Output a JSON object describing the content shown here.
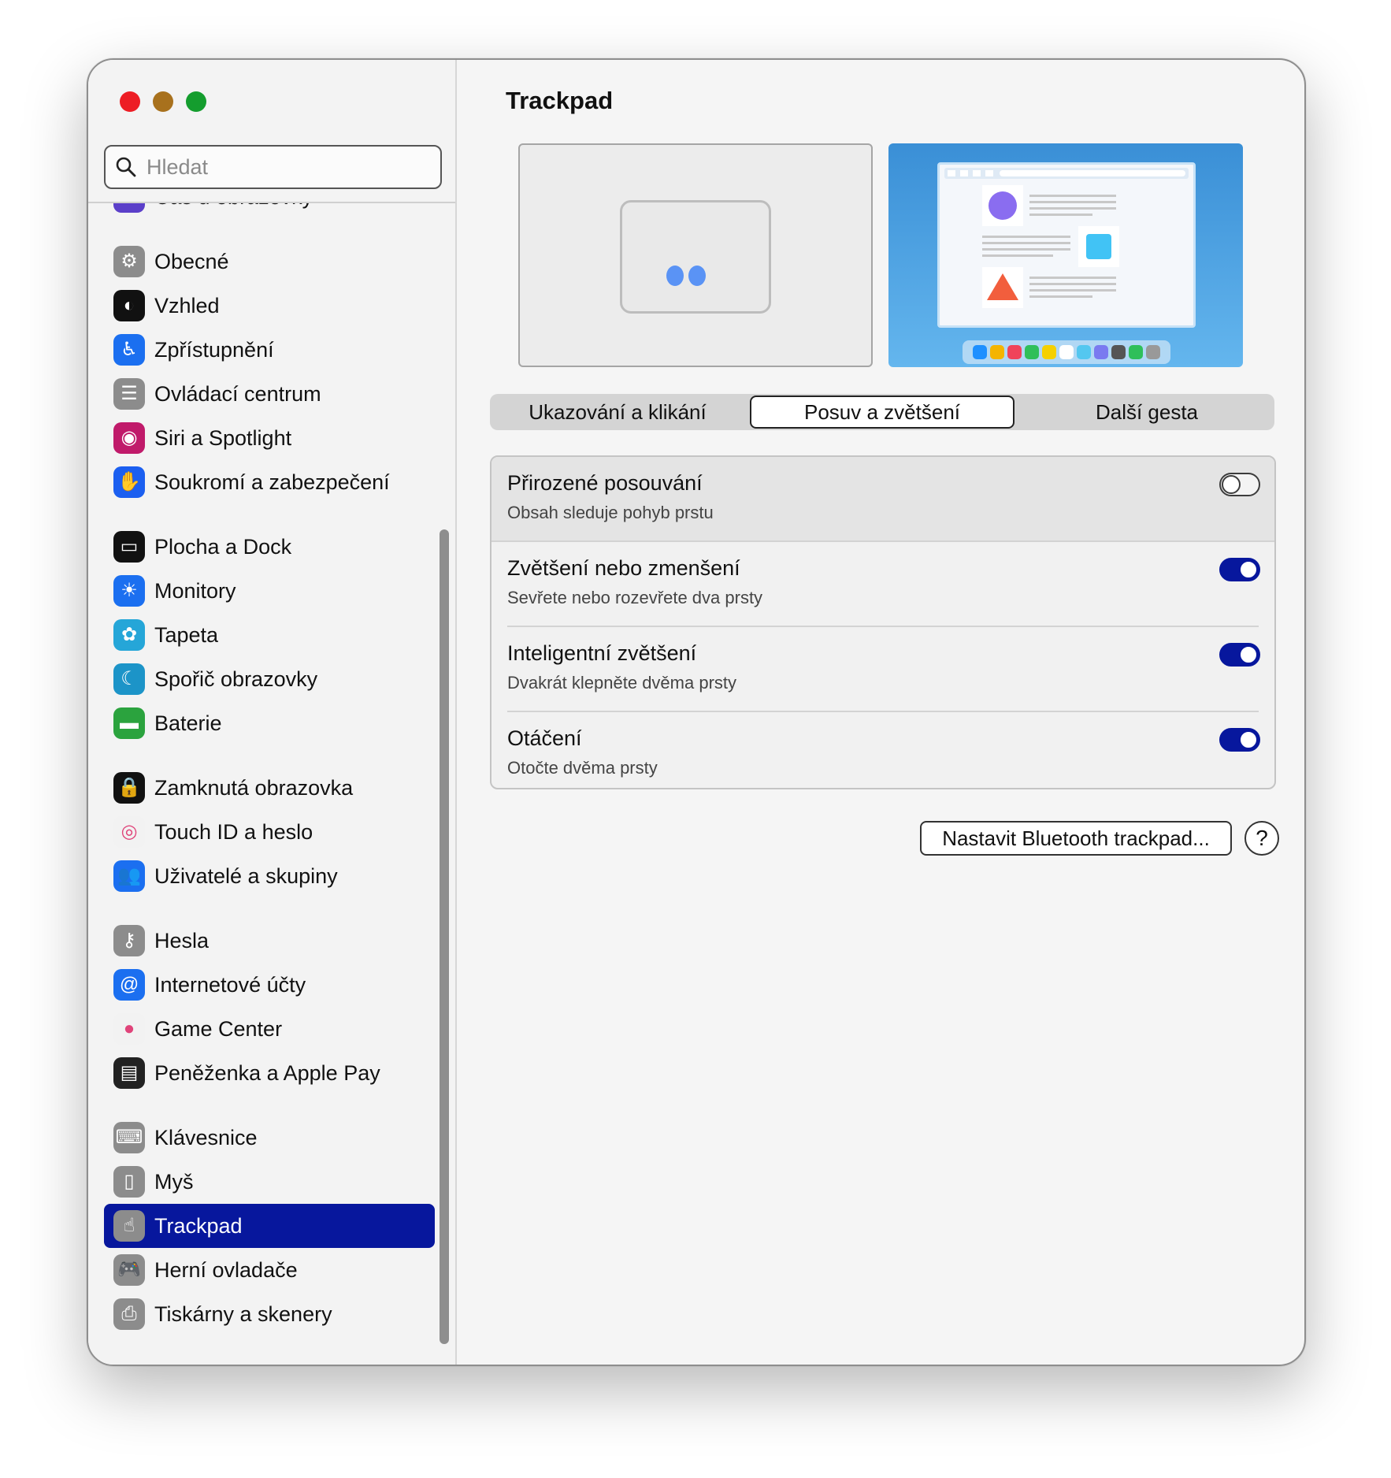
{
  "window": {
    "title": "Trackpad"
  },
  "search": {
    "placeholder": "Hledat"
  },
  "sidebar": {
    "groups": [
      [
        {
          "label": "Čas u obrazovky",
          "icon": "hourglass-icon",
          "color": "#5b3fc9"
        }
      ],
      [
        {
          "label": "Obecné",
          "icon": "gear-icon",
          "color": "#8c8c8c"
        },
        {
          "label": "Vzhled",
          "icon": "appearance-icon",
          "color": "#111111"
        },
        {
          "label": "Zpřístupnění",
          "icon": "accessibility-icon",
          "color": "#1b6ff0"
        },
        {
          "label": "Ovládací centrum",
          "icon": "control-center-icon",
          "color": "#8c8c8c"
        },
        {
          "label": "Siri a Spotlight",
          "icon": "siri-icon",
          "color": "#c01a6a"
        },
        {
          "label": "Soukromí a zabezpečení",
          "icon": "hand-icon",
          "color": "#1b5ff0"
        }
      ],
      [
        {
          "label": "Plocha a Dock",
          "icon": "dock-icon",
          "color": "#111111"
        },
        {
          "label": "Monitory",
          "icon": "sun-icon",
          "color": "#1b6ff0"
        },
        {
          "label": "Tapeta",
          "icon": "flower-icon",
          "color": "#25a6d8"
        },
        {
          "label": "Spořič obrazovky",
          "icon": "screensaver-icon",
          "color": "#1c94c8"
        },
        {
          "label": "Baterie",
          "icon": "battery-icon",
          "color": "#2ba33e"
        }
      ],
      [
        {
          "label": "Zamknutá obrazovka",
          "icon": "lock-icon",
          "color": "#111111"
        },
        {
          "label": "Touch ID a heslo",
          "icon": "fingerprint-icon",
          "color": "#f2f2f2"
        },
        {
          "label": "Uživatelé a skupiny",
          "icon": "users-icon",
          "color": "#1b6ff0"
        }
      ],
      [
        {
          "label": "Hesla",
          "icon": "key-icon",
          "color": "#8c8c8c"
        },
        {
          "label": "Internetové účty",
          "icon": "at-icon",
          "color": "#1b6ff0"
        },
        {
          "label": "Game Center",
          "icon": "game-center-icon",
          "color": "#f2f2f2"
        },
        {
          "label": "Peněženka a Apple Pay",
          "icon": "wallet-icon",
          "color": "#222222"
        }
      ],
      [
        {
          "label": "Klávesnice",
          "icon": "keyboard-icon",
          "color": "#8c8c8c"
        },
        {
          "label": "Myš",
          "icon": "mouse-icon",
          "color": "#8c8c8c"
        },
        {
          "label": "Trackpad",
          "icon": "trackpad-icon",
          "color": "#8c8c8c",
          "active": true
        },
        {
          "label": "Herní ovladače",
          "icon": "gamepad-icon",
          "color": "#8c8c8c"
        },
        {
          "label": "Tiskárny a skenery",
          "icon": "printer-icon",
          "color": "#8c8c8c"
        }
      ]
    ]
  },
  "tabs": [
    {
      "label": "Ukazování a klikání",
      "active": false
    },
    {
      "label": "Posuv a zvětšení",
      "active": true
    },
    {
      "label": "Další gesta",
      "active": false
    }
  ],
  "settings": [
    {
      "label": "Přirozené posouvání",
      "sub": "Obsah sleduje pohyb prstu",
      "on": false
    },
    {
      "label": "Zvětšení nebo zmenšení",
      "sub": "Sevřete nebo rozevřete dva prsty",
      "on": true
    },
    {
      "label": "Inteligentní zvětšení",
      "sub": "Dvakrát klepněte dvěma prsty",
      "on": true
    },
    {
      "label": "Otáčení",
      "sub": "Otočte dvěma prsty",
      "on": true
    }
  ],
  "buttons": {
    "bluetooth": "Nastavit Bluetooth trackpad...",
    "help": "?"
  },
  "colors": {
    "accent": "#07179d"
  }
}
